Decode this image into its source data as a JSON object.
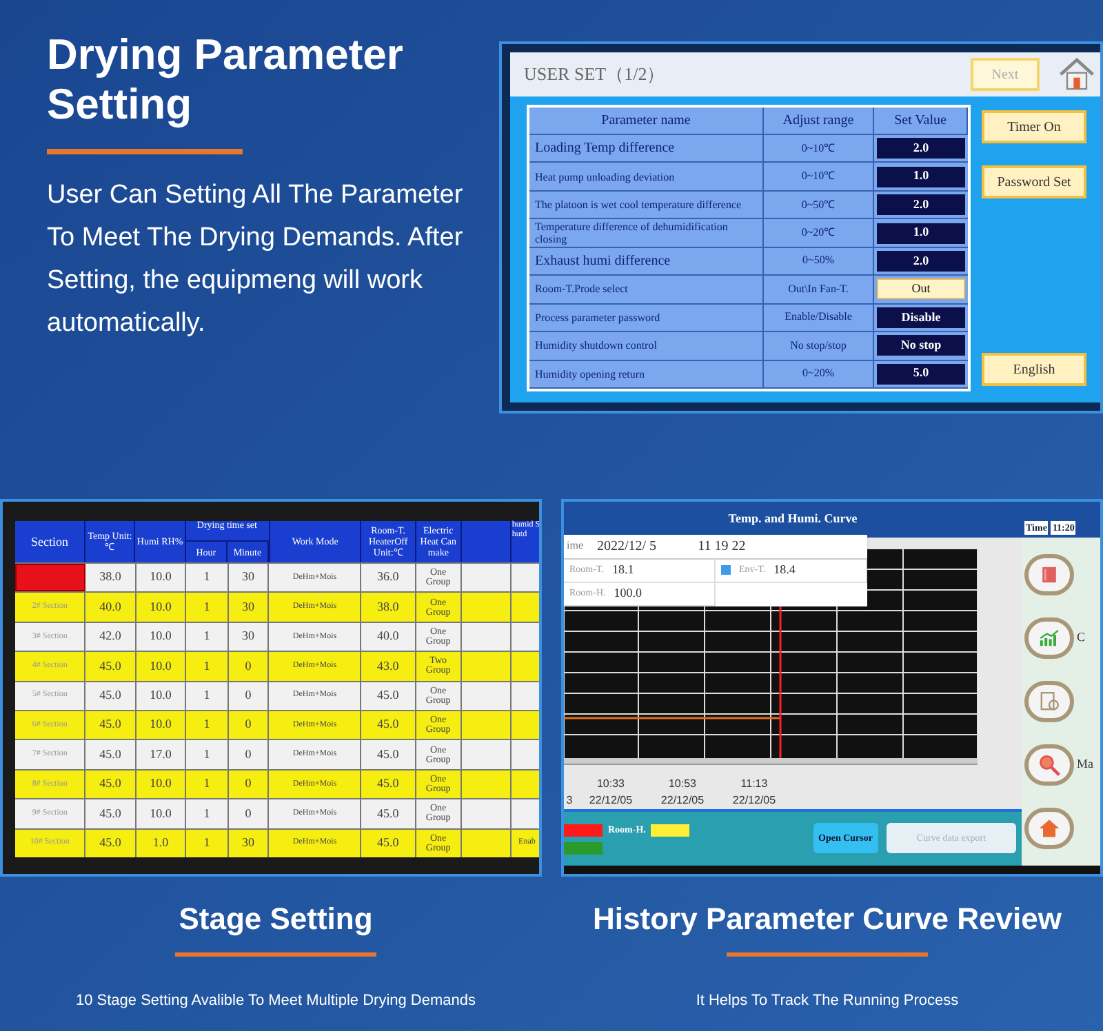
{
  "intro": {
    "title": "Drying Parameter Setting",
    "body": "User Can Setting All The Parameter To Meet The Drying Demands. After Setting, the equipmeng will work  automatically."
  },
  "user_set": {
    "title": "USER SET（1/2）",
    "next_button": "Next",
    "columns": [
      "Parameter name",
      "Adjust range",
      "Set Value"
    ],
    "rows": [
      {
        "name": "Loading Temp difference",
        "range": "0~10℃",
        "value": "2.0",
        "kind": "display"
      },
      {
        "name": "Heat pump unloading deviation",
        "range": "0~10℃",
        "value": "1.0",
        "kind": "display"
      },
      {
        "name": "The platoon is wet cool temperature difference",
        "range": "0~50℃",
        "value": "2.0",
        "kind": "display"
      },
      {
        "name": "Temperature difference of dehumidification closing",
        "range": "0~20℃",
        "value": "1.0",
        "kind": "display"
      },
      {
        "name": "Exhaust humi difference",
        "range": "0~50%",
        "value": "2.0",
        "kind": "display"
      },
      {
        "name": "Room-T.Prode select",
        "range": "Out\\In Fan-T.",
        "value": "Out",
        "kind": "toggle"
      },
      {
        "name": "Process parameter password",
        "range": "Enable/Disable",
        "value": "Disable",
        "kind": "display"
      },
      {
        "name": "Humidity shutdown control",
        "range": "No stop/stop",
        "value": "No stop",
        "kind": "display"
      },
      {
        "name": "Humidity opening return",
        "range": "0~20%",
        "value": "5.0",
        "kind": "display"
      }
    ],
    "side_buttons": [
      "Timer On",
      "Password Set",
      "English"
    ]
  },
  "stage_table": {
    "column_group": "Drying time set",
    "columns": [
      "Section",
      "Temp Unit:℃",
      "Humi RH%",
      "Hour",
      "Minute",
      "Work Mode",
      "Room-T. HeaterOff Unit:℃",
      "Electric Heat Can make",
      "",
      "humid Shutd"
    ],
    "rows": [
      {
        "alarm": true,
        "highlighted": false,
        "cells": [
          "",
          "38.0",
          "10.0",
          "1",
          "30",
          "DeHm+Mois",
          "36.0",
          "One Group"
        ]
      },
      {
        "alarm": false,
        "highlighted": true,
        "cells": [
          "2# Section",
          "40.0",
          "10.0",
          "1",
          "30",
          "DeHm+Mois",
          "38.0",
          "One Group"
        ]
      },
      {
        "alarm": false,
        "highlighted": false,
        "cells": [
          "3# Section",
          "42.0",
          "10.0",
          "1",
          "30",
          "DeHm+Mois",
          "40.0",
          "One Group"
        ]
      },
      {
        "alarm": false,
        "highlighted": true,
        "cells": [
          "4# Section",
          "45.0",
          "10.0",
          "1",
          "0",
          "DeHm+Mois",
          "43.0",
          "Two Group"
        ]
      },
      {
        "alarm": false,
        "highlighted": false,
        "cells": [
          "5# Section",
          "45.0",
          "10.0",
          "1",
          "0",
          "DeHm+Mois",
          "45.0",
          "One Group"
        ]
      },
      {
        "alarm": false,
        "highlighted": true,
        "cells": [
          "6# Section",
          "45.0",
          "10.0",
          "1",
          "0",
          "DeHm+Mois",
          "45.0",
          "One Group"
        ]
      },
      {
        "alarm": false,
        "highlighted": false,
        "cells": [
          "7# Section",
          "45.0",
          "17.0",
          "1",
          "0",
          "DeHm+Mois",
          "45.0",
          "One Group"
        ]
      },
      {
        "alarm": false,
        "highlighted": true,
        "cells": [
          "8# Section",
          "45.0",
          "10.0",
          "1",
          "0",
          "DeHm+Mois",
          "45.0",
          "One Group"
        ]
      },
      {
        "alarm": false,
        "highlighted": false,
        "cells": [
          "9# Section",
          "45.0",
          "10.0",
          "1",
          "0",
          "DeHm+Mois",
          "45.0",
          "One Group"
        ]
      },
      {
        "alarm": false,
        "highlighted": true,
        "cells": [
          "10# Section",
          "45.0",
          "1.0",
          "1",
          "30",
          "DeHm+Mois",
          "45.0",
          "One Group",
          "",
          "Enab"
        ]
      }
    ]
  },
  "curve": {
    "title": "Temp. and Humi. Curve",
    "time_label": "Time",
    "time_value": "11:20",
    "info": {
      "time_label": "ime",
      "date": "2022/12/ 5",
      "clock": "11 19 22",
      "rows": [
        {
          "label": "Room-T.",
          "value": "18.1"
        },
        {
          "label": "Env-T.",
          "value": "18.4",
          "color": "#3d9be9"
        },
        {
          "label": "Room-H.",
          "value": "100.0"
        }
      ]
    },
    "x_labels": [
      {
        "time": "3"
      },
      {
        "time": "10:33",
        "date": "22/12/05"
      },
      {
        "time": "10:53",
        "date": "22/12/05"
      },
      {
        "time": "11:13",
        "date": "22/12/05"
      }
    ],
    "legend": [
      {
        "color": "#ff1a1a"
      },
      {
        "label": "Room-H.",
        "color": "#ffee33"
      },
      {
        "color": "#2a9a2a"
      }
    ],
    "buttons": [
      {
        "label": "Open Cursor",
        "disabled": false
      },
      {
        "label": "Curve data export",
        "disabled": true
      }
    ],
    "side_buttons": [
      {
        "kind": "book"
      },
      {
        "kind": "chart",
        "label": "C"
      },
      {
        "kind": "clipboard"
      },
      {
        "kind": "search",
        "label": "Ma"
      },
      {
        "kind": "home"
      }
    ]
  },
  "captions": [
    {
      "title": "Stage Setting",
      "subtitle": "10 Stage Setting Avalible To Meet Multiple Drying Demands"
    },
    {
      "title": "History Parameter Curve Review",
      "subtitle": "It Helps To Track The Running Process"
    }
  ]
}
